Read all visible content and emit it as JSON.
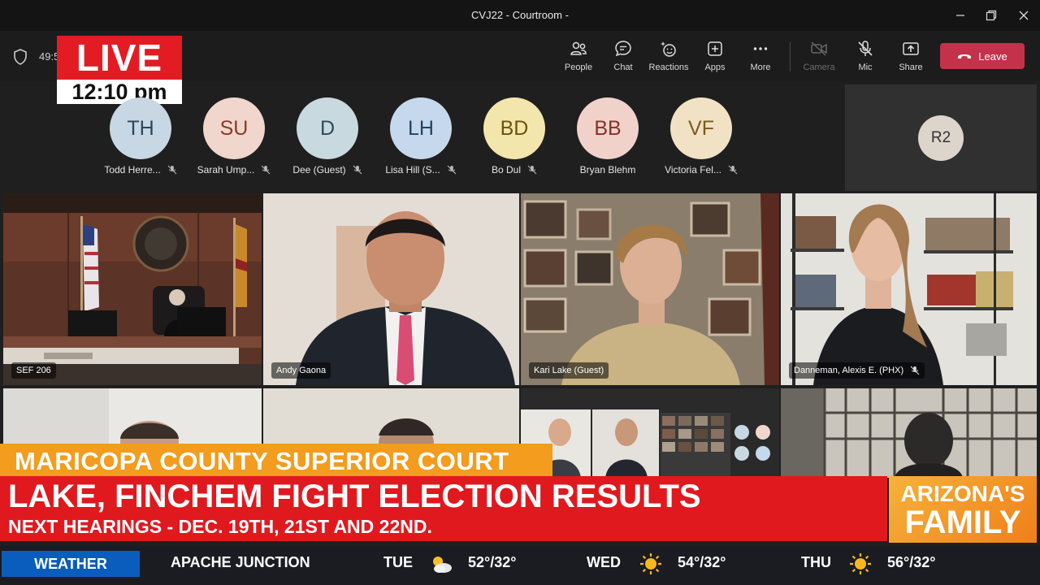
{
  "window": {
    "title": "CVJ22 - Courtroom -"
  },
  "toolbar": {
    "timer": "49:5",
    "buttons": [
      {
        "label": "People",
        "icon": "people-icon"
      },
      {
        "label": "Chat",
        "icon": "chat-icon"
      },
      {
        "label": "Reactions",
        "icon": "reactions-icon"
      },
      {
        "label": "Apps",
        "icon": "apps-icon"
      },
      {
        "label": "More",
        "icon": "more-icon"
      },
      {
        "label": "Camera",
        "icon": "camera-off-icon"
      },
      {
        "label": "Mic",
        "icon": "mic-off-icon"
      },
      {
        "label": "Share",
        "icon": "share-icon"
      }
    ],
    "leave_label": "Leave"
  },
  "live_bug": {
    "live": "LIVE",
    "time": "12:10 pm"
  },
  "participants": [
    {
      "initials": "TH",
      "name": "Todd Herre...",
      "color": "#c7d7e4",
      "text": "#2b4660",
      "muted": true
    },
    {
      "initials": "SU",
      "name": "Sarah Ump...",
      "color": "#f1d6cd",
      "text": "#8a3a27",
      "muted": true
    },
    {
      "initials": "D",
      "name": "Dee (Guest)",
      "color": "#c9d9e0",
      "text": "#2d4c5c",
      "muted": true
    },
    {
      "initials": "LH",
      "name": "Lisa Hill (S...",
      "color": "#c6d9ec",
      "text": "#214466",
      "muted": true
    },
    {
      "initials": "BD",
      "name": "Bo Dul",
      "color": "#f3e6ad",
      "text": "#6b5410",
      "muted": true
    },
    {
      "initials": "BB",
      "name": "Bryan Blehm",
      "color": "#f1d2ca",
      "text": "#84332a",
      "muted": false
    },
    {
      "initials": "VF",
      "name": "Victoria Fel...",
      "color": "#f2e2c5",
      "text": "#7b5a1c",
      "muted": true
    }
  ],
  "room": {
    "initials": "R2"
  },
  "tiles": [
    {
      "label": "SEF 206",
      "muted": false
    },
    {
      "label": "Andy Gaona",
      "muted": false
    },
    {
      "label": "Kari Lake (Guest)",
      "muted": false
    },
    {
      "label": "Danneman, Alexis E. (PHX)",
      "muted": true
    }
  ],
  "lower_third": {
    "kicker": "MARICOPA COUNTY SUPERIOR COURT",
    "headline": "LAKE, FINCHEM FIGHT ELECTION RESULTS",
    "subline": "NEXT HEARINGS - DEC. 19TH, 21ST AND 22ND.",
    "logo_line1": "ARIZONA'S",
    "logo_line2": "FAMILY"
  },
  "ticker": {
    "badge": "WEATHER",
    "location": "APACHE JUNCTION",
    "forecast": [
      {
        "day": "TUE",
        "icon": "partly-cloudy-icon",
        "temp": "52°/32°"
      },
      {
        "day": "WED",
        "icon": "sun-icon",
        "temp": "54°/32°"
      },
      {
        "day": "THU",
        "icon": "sun-icon",
        "temp": "56°/32°"
      }
    ]
  },
  "colors": {
    "leave": "#c4314b",
    "live_red": "#e31b23",
    "kicker_orange": "#f39c1e",
    "headline_red": "#e0191f",
    "weather_blue": "#0b5dbd"
  }
}
